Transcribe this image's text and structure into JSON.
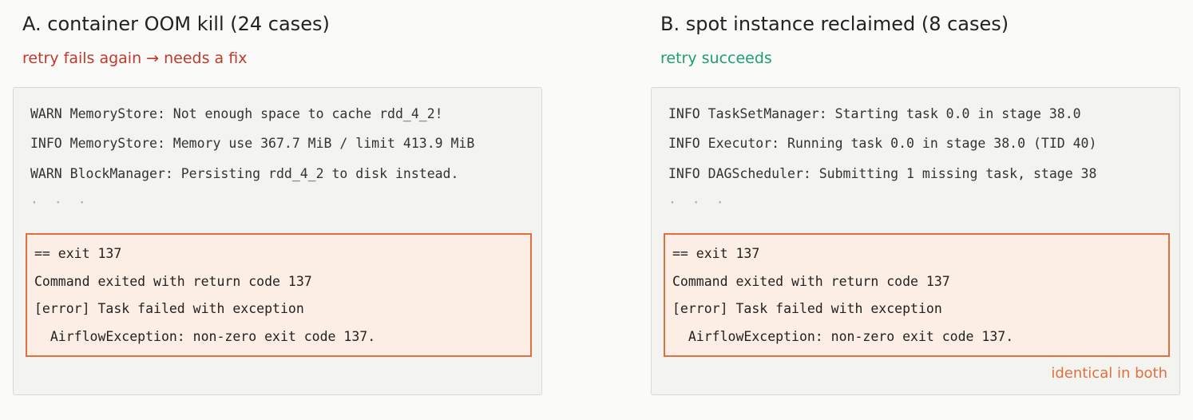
{
  "panels": {
    "a": {
      "title": "A. container OOM kill  (24 cases)",
      "subtitle": "retry fails again  →  needs a fix",
      "log_lines": [
        "WARN MemoryStore: Not enough space to cache rdd_4_2!",
        "INFO MemoryStore: Memory use 367.7 MiB / limit 413.9 MiB",
        "WARN BlockManager: Persisting rdd_4_2 to disk instead."
      ],
      "ellipsis": "·  ·  ·",
      "exit_lines": [
        "== exit 137",
        "Command exited with return code 137",
        "[error] Task failed with exception",
        "  AirflowException: non-zero exit code 137."
      ]
    },
    "b": {
      "title": "B. spot instance reclaimed  (8 cases)",
      "subtitle": "retry succeeds",
      "log_lines": [
        "INFO TaskSetManager: Starting task 0.0 in stage 38.0",
        "INFO Executor: Running task 0.0 in stage 38.0 (TID 40)",
        "INFO DAGScheduler: Submitting 1 missing task, stage 38"
      ],
      "ellipsis": "·  ·  ·",
      "exit_lines": [
        "== exit 137",
        "Command exited with return code 137",
        "[error] Task failed with exception",
        "  AirflowException: non-zero exit code 137."
      ],
      "note": "identical in both"
    }
  },
  "colors": {
    "fail": "#c0392b",
    "success": "#1e9e72",
    "highlight": "#e07040"
  }
}
